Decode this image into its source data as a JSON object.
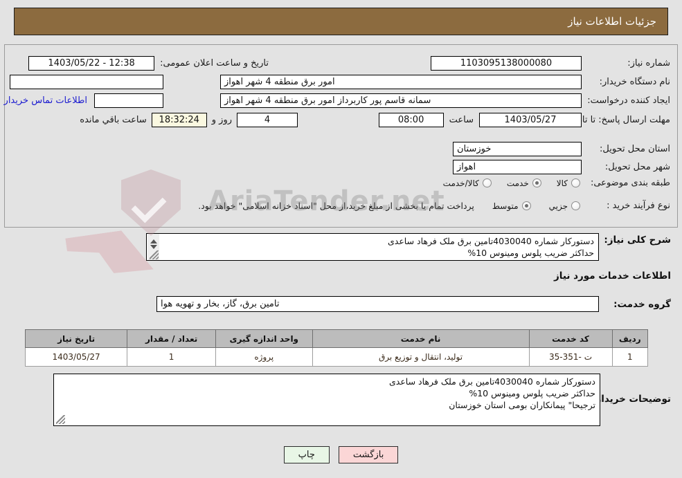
{
  "header": {
    "title": "جزئیات اطلاعات نیاز"
  },
  "form": {
    "need_number_label": "شماره نیاز:",
    "need_number_value": "1103095138000080",
    "buyer_org_label": "نام دستگاه خریدار:",
    "buyer_org_value": "امور برق منطقه 4 شهر اهواز",
    "creator_label": "ایجاد کننده درخواست:",
    "creator_value": "سمانه قاسم پور کاربرداز امور برق منطقه 4 شهر اهواز",
    "deadline_label": "مهلت ارسال پاسخ: تا تاریخ:",
    "deadline_date": "1403/05/27",
    "hour_label": "ساعت",
    "deadline_time": "08:00",
    "province_label": "استان محل تحویل:",
    "province_value": "خوزستان",
    "city_label": "شهر محل تحویل:",
    "city_value": "اهواز",
    "classification_label": "طبقه بندی موضوعی:",
    "process_type_label": "نوع فرآیند خرید :",
    "announce_label": "تاریخ و ساعت اعلان عمومی:",
    "announce_value": "1403/05/22 - 12:38",
    "empty_field_value": "",
    "contact_link": "اطلاعات تماس خریدار",
    "days_value": "4",
    "days_label": "روز و",
    "countdown_value": "18:32:24",
    "remaining_label": "ساعت باقي مانده",
    "treasury_note": "پرداخت تمام یا بخشی از مبلغ خرید،از محل \"اسناد خزانه اسلامی\" خواهد بود."
  },
  "classification_options": [
    {
      "label": "کالا",
      "selected": false
    },
    {
      "label": "خدمت",
      "selected": true
    },
    {
      "label": "کالا/خدمت",
      "selected": false
    }
  ],
  "process_options": [
    {
      "label": "جزیي",
      "selected": false
    },
    {
      "label": "متوسط",
      "selected": true
    }
  ],
  "description": {
    "label": "شرح کلی نیاز:",
    "value": "دستورکار شماره 4030040تامین برق ملک فرهاد ساعدی\nحداکثر ضریب پلوس ومینوس 10%"
  },
  "services_section": {
    "title": "اطلاعات خدمات مورد نیاز",
    "group_label": "گروه خدمت:",
    "group_value": "تامین برق، گاز، بخار و تهویه هوا"
  },
  "table": {
    "columns": [
      "ردیف",
      "کد خدمت",
      "نام خدمت",
      "واحد اندازه گیری",
      "تعداد / مقدار",
      "تاریخ نیاز"
    ],
    "rows": [
      {
        "row_no": "1",
        "service_code": "ت -351-35",
        "service_name": "تولید، انتقال و توزیع برق",
        "unit": "پروژه",
        "quantity": "1",
        "need_date": "1403/05/27"
      }
    ]
  },
  "buyer_notes": {
    "label": "توضیحات خریدار:",
    "value": "دستورکار شماره 4030040تامین برق ملک فرهاد ساعدی\nحداکثر ضریب پلوس ومینوس 10%\nترجیحا\" پیمانکاران بومی استان خوزستان"
  },
  "buttons": {
    "print": "چاپ",
    "back": "بازگشت"
  },
  "watermark": {
    "text": "AriaTender.net"
  },
  "colors": {
    "header_bg": "#8c6b3f",
    "page_bg": "#e3e3e3",
    "link": "#1b1bd0",
    "table_header_bg": "#bcbcbc",
    "print_btn_bg": "#e8f6e6",
    "back_btn_bg": "#fbd6d6",
    "countdown_bg": "#faf8e0"
  }
}
